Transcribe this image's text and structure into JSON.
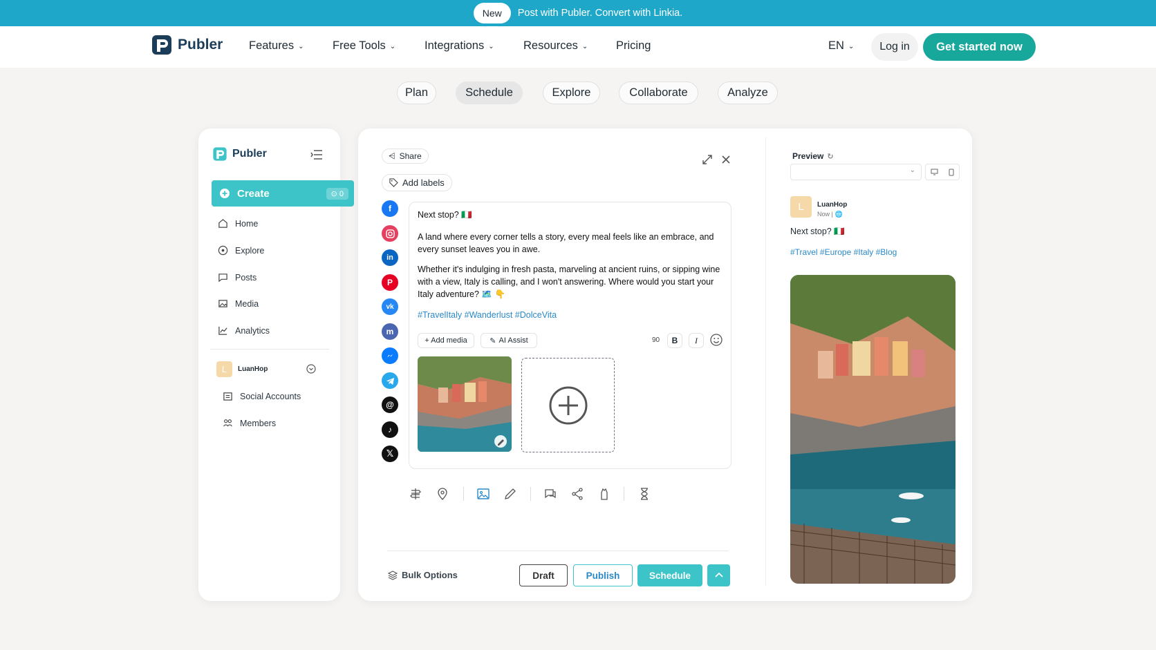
{
  "banner": {
    "badge": "New",
    "text": "Post with Publer. Convert with Linkia."
  },
  "nav": {
    "logo": "Publer",
    "items": [
      "Features",
      "Free Tools",
      "Integrations",
      "Resources",
      "Pricing"
    ],
    "lang": "EN",
    "login": "Log in",
    "cta": "Get started now"
  },
  "tabs": [
    "Plan",
    "Schedule",
    "Explore",
    "Collaborate",
    "Analyze"
  ],
  "sidebar": {
    "logo": "Publer",
    "create": "Create",
    "create_count": "0",
    "items": [
      "Home",
      "Explore",
      "Posts",
      "Media",
      "Analytics"
    ],
    "workspace_initial": "L",
    "workspace_name": "LuanHop",
    "sub_items": [
      "Social Accounts",
      "Members"
    ]
  },
  "composer": {
    "share": "Share",
    "add_labels": "Add labels",
    "line1": "Next stop? 🇮🇹",
    "para1": "A land where every corner tells a story, every meal feels like an embrace, and every sunset leaves you in awe.",
    "para2": "Whether it's indulging in fresh pasta, marveling at ancient ruins, or sipping wine with a view, Italy is calling, and I won't answering. Where would you start your Italy adventure? 🗺️ 👇",
    "hashtags": "#TravelItaly #Wanderlust #DolceVita",
    "add_media": "+ Add media",
    "ai_assist": "AI Assist",
    "char_count": "90",
    "bold": "B",
    "italic": "I",
    "bulk_options": "Bulk Options",
    "draft": "Draft",
    "publish": "Publish",
    "schedule": "Schedule"
  },
  "preview": {
    "title": "Preview",
    "initial": "L",
    "name": "LuanHop",
    "time": "Now |",
    "text": "Next stop? 🇮🇹",
    "hashtags": "#Travel #Europe #Italy #Blog"
  },
  "colors": {
    "banner": "#1fa7c9",
    "brand_teal": "#18a79b",
    "create_bg": "#3dc4c8",
    "hashtag": "#2a89c9"
  }
}
